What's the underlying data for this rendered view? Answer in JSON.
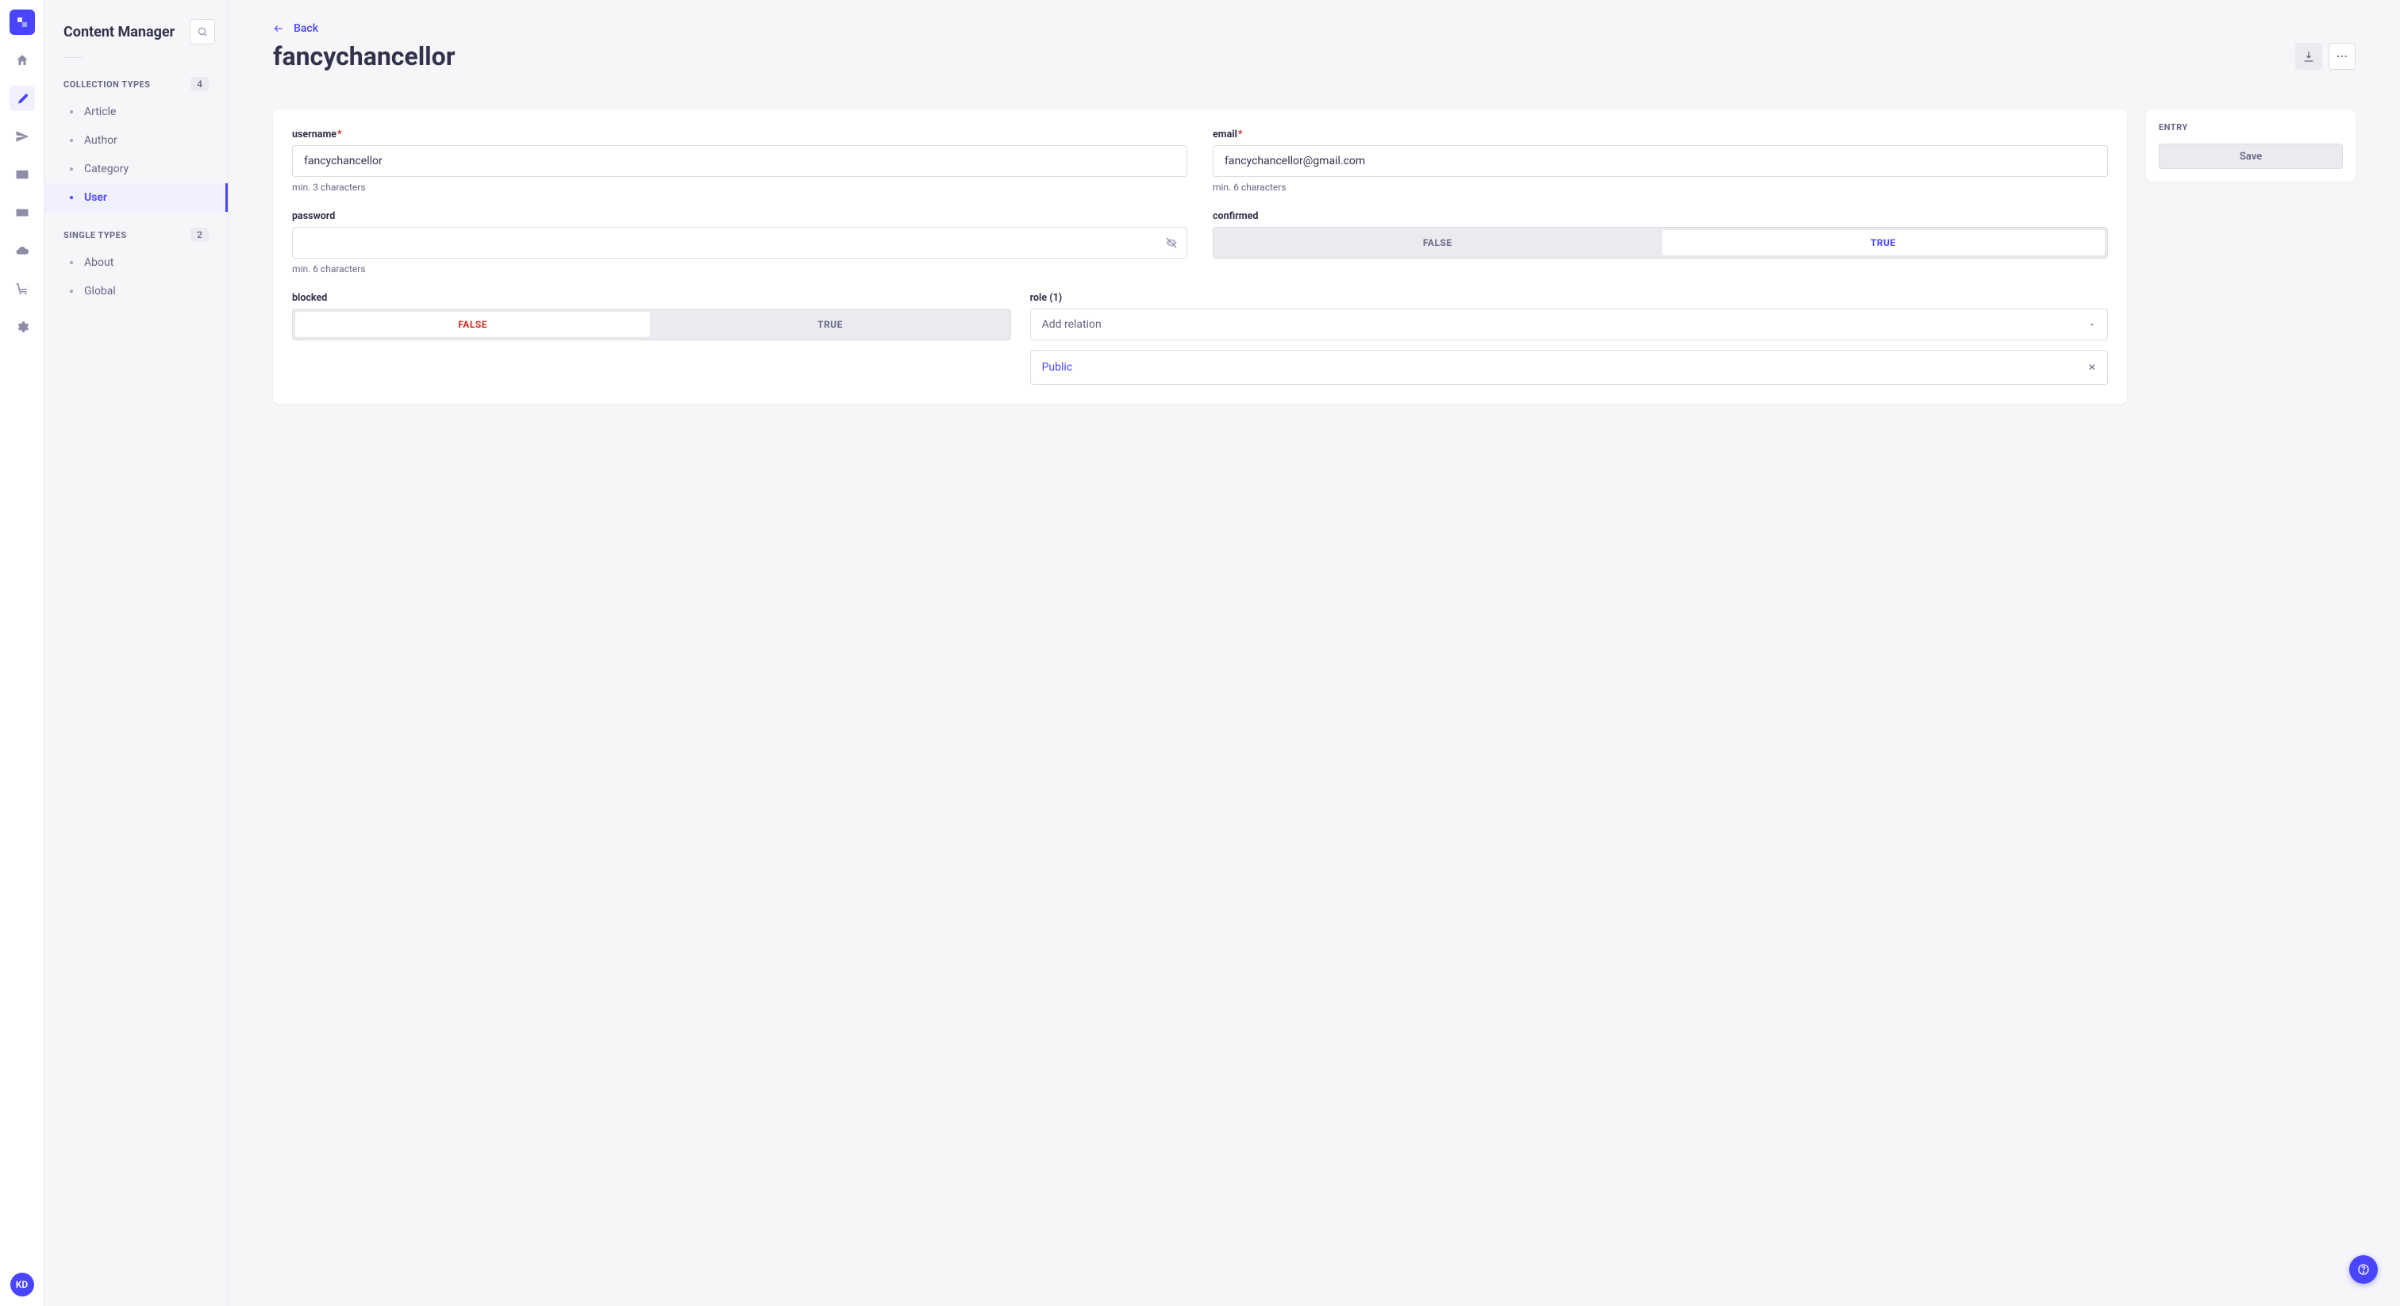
{
  "rail": {
    "avatar_initials": "KD"
  },
  "secondary": {
    "title": "Content Manager",
    "section_collection_label": "COLLECTION TYPES",
    "section_collection_count": "4",
    "collection_items": [
      "Article",
      "Author",
      "Category",
      "User"
    ],
    "section_single_label": "SINGLE TYPES",
    "section_single_count": "2",
    "single_items": [
      "About",
      "Global"
    ]
  },
  "header": {
    "back_label": "Back",
    "title": "fancychancellor"
  },
  "form": {
    "username": {
      "label": "username",
      "value": "fancychancellor",
      "hint": "min. 3 characters"
    },
    "email": {
      "label": "email",
      "value": "fancychancellor@gmail.com",
      "hint": "min. 6 characters"
    },
    "password": {
      "label": "password",
      "hint": "min. 6 characters"
    },
    "confirmed": {
      "label": "confirmed",
      "option_false": "FALSE",
      "option_true": "TRUE"
    },
    "blocked": {
      "label": "blocked",
      "option_false": "FALSE",
      "option_true": "TRUE"
    },
    "role": {
      "label": "role (1)",
      "placeholder": "Add relation",
      "chip": "Public"
    }
  },
  "entry": {
    "label": "ENTRY",
    "save": "Save"
  }
}
